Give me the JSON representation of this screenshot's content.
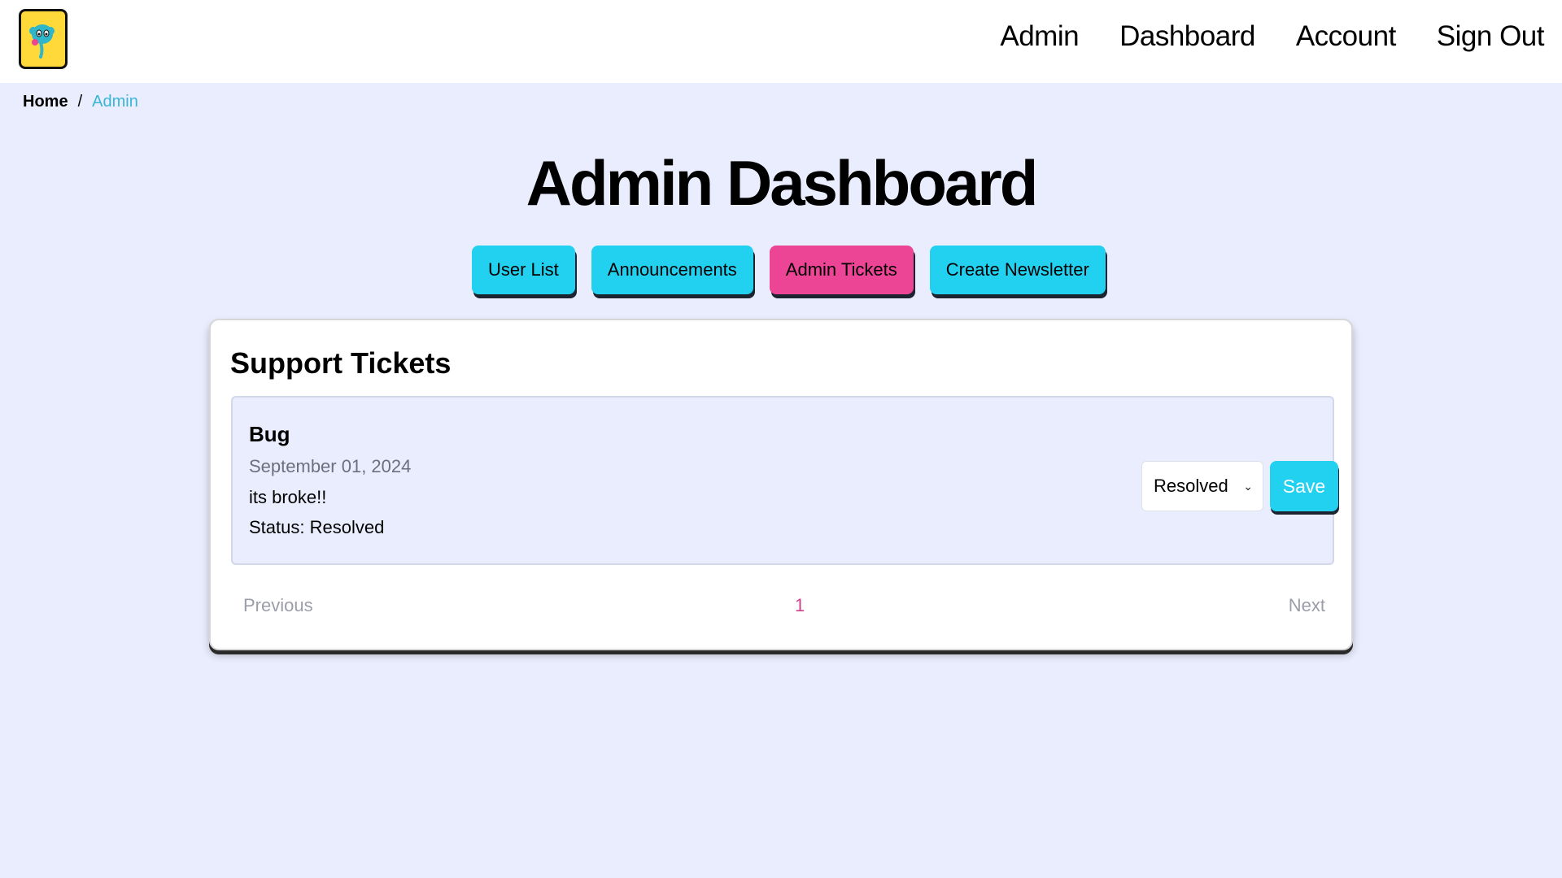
{
  "nav": {
    "items": [
      {
        "label": "Admin"
      },
      {
        "label": "Dashboard"
      },
      {
        "label": "Account"
      },
      {
        "label": "Sign Out"
      }
    ]
  },
  "breadcrumb": {
    "home": "Home",
    "separator": "/",
    "current": "Admin"
  },
  "page": {
    "title": "Admin Dashboard"
  },
  "tabs": [
    {
      "label": "User List",
      "active": false
    },
    {
      "label": "Announcements",
      "active": false
    },
    {
      "label": "Admin Tickets",
      "active": true
    },
    {
      "label": "Create Newsletter",
      "active": false
    }
  ],
  "tickets_section": {
    "title": "Support Tickets",
    "tickets": [
      {
        "type": "Bug",
        "date": "September 01, 2024",
        "description": "its broke!!",
        "status_label": "Status: Resolved",
        "selected_status": "Resolved",
        "save_label": "Save"
      }
    ],
    "pagination": {
      "previous": "Previous",
      "page": "1",
      "next": "Next"
    }
  },
  "colors": {
    "background": "#eaedfd",
    "accent_cyan": "#22d1f0",
    "accent_pink": "#ec4596",
    "logo_yellow": "#ffd83a"
  },
  "icons": {
    "logo": "mascot-logo-icon",
    "select_arrow": "chevron-down-icon"
  }
}
